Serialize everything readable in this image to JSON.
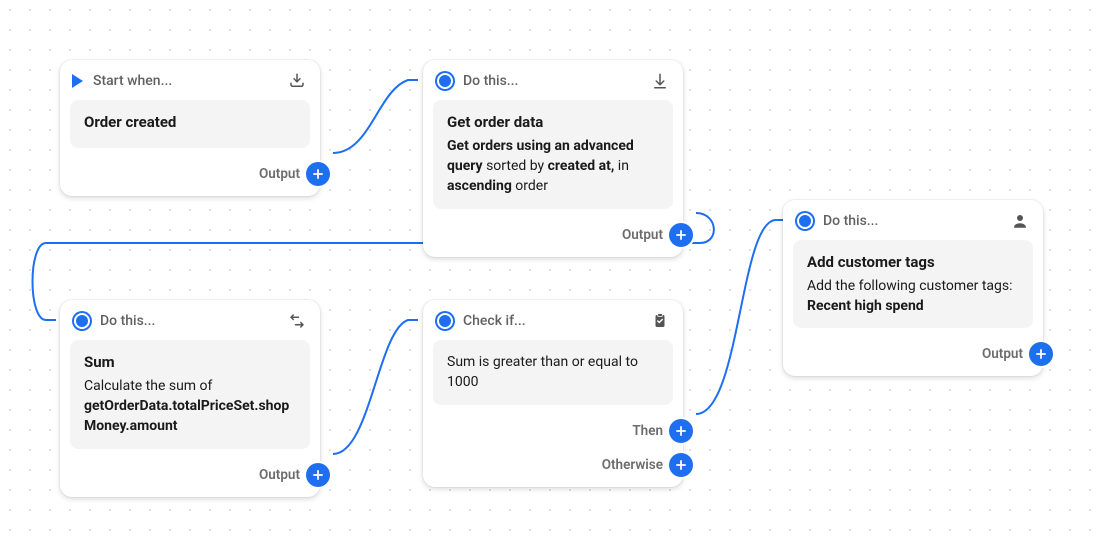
{
  "nodes": {
    "trigger": {
      "header": "Start when...",
      "title": "Order created",
      "outputs": [
        {
          "label": "Output"
        }
      ],
      "icon": "import"
    },
    "getdata": {
      "header": "Do this...",
      "title": "Get order data",
      "desc_pre": "Get orders using an advanced query",
      "desc_mid1": " sorted by ",
      "desc_b1": "created at,",
      "desc_mid2": " in ",
      "desc_b2": "ascending",
      "desc_tail": " order",
      "outputs": [
        {
          "label": "Output"
        }
      ],
      "icon": "download"
    },
    "sum": {
      "header": "Do this...",
      "title": "Sum",
      "desc_pre": "Calculate the sum of ",
      "desc_b1": "getOrderData.totalPriceSet.shopMoney.amount",
      "outputs": [
        {
          "label": "Output"
        }
      ],
      "icon": "transform"
    },
    "check": {
      "header": "Check if...",
      "body": "Sum is greater than or equal to 1000",
      "outputs": [
        {
          "label": "Then"
        },
        {
          "label": "Otherwise"
        }
      ],
      "icon": "clipboard"
    },
    "action": {
      "header": "Do this...",
      "title": "Add customer tags",
      "desc_pre": "Add the following customer tags: ",
      "desc_b1": "Recent high spend",
      "outputs": [
        {
          "label": "Output"
        }
      ],
      "icon": "person"
    }
  }
}
